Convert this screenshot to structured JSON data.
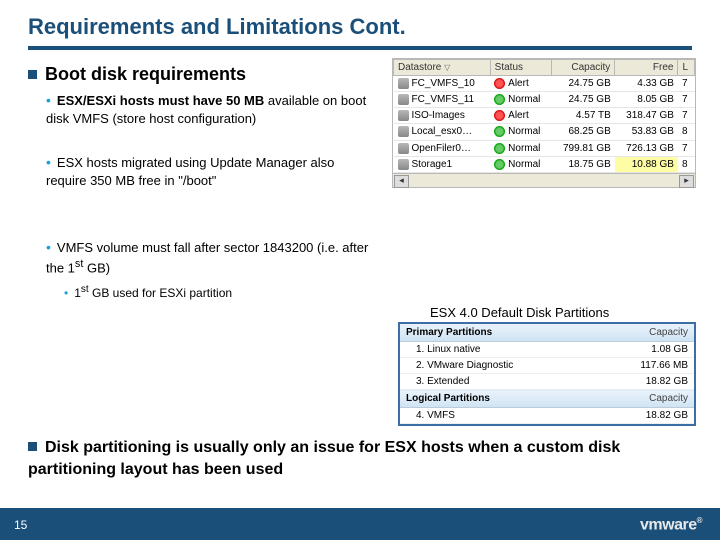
{
  "title": "Requirements and Limitations Cont.",
  "headings": {
    "h1": "Boot disk requirements",
    "b1": "ESX/ESXi hosts must have 50 MB",
    "b1_rest": " available on boot disk VMFS (store host configuration)",
    "b2": "ESX hosts migrated using Update Manager also require 350 MB free in \"/boot\"",
    "b3": "VMFS volume must fall after sector 1843200 (i.e. after the 1",
    "b3_sup": "st",
    "b3_rest": " GB)",
    "b3a": "1",
    "b3a_sup": "st",
    "b3a_rest": " GB used for ESXi partition"
  },
  "datastores": {
    "cols": {
      "c1": "Datastore",
      "c2": "Status",
      "c3": "Capacity",
      "c4": "Free",
      "c5": "L"
    },
    "rows": [
      {
        "name": "FC_VMFS_10",
        "status": "Alert",
        "s": "alert",
        "cap": "24.75 GB",
        "free": "4.33 GB",
        "l": "7"
      },
      {
        "name": "FC_VMFS_11",
        "status": "Normal",
        "s": "ok",
        "cap": "24.75 GB",
        "free": "8.05 GB",
        "l": "7"
      },
      {
        "name": "ISO-Images",
        "status": "Alert",
        "s": "alert",
        "cap": "4.57 TB",
        "free": "318.47 GB",
        "l": "7"
      },
      {
        "name": "Local_esx0…",
        "status": "Normal",
        "s": "ok",
        "cap": "68.25 GB",
        "free": "53.83 GB",
        "l": "8"
      },
      {
        "name": "OpenFiler0…",
        "status": "Normal",
        "s": "ok",
        "cap": "799.81 GB",
        "free": "726.13 GB",
        "l": "7"
      },
      {
        "name": "Storage1",
        "status": "Normal",
        "s": "ok",
        "cap": "18.75 GB",
        "free": "10.88 GB",
        "hl": true,
        "l": "8"
      }
    ]
  },
  "caption": "ESX 4.0 Default Disk Partitions",
  "partitions": {
    "h1": "Primary Partitions",
    "h1r": "Capacity",
    "r1": "1. Linux native",
    "r1v": "1.08 GB",
    "r2": "2. VMware Diagnostic",
    "r2v": "117.66 MB",
    "r3": "3. Extended",
    "r3v": "18.82 GB",
    "h2": "Logical Partitions",
    "h2r": "Capacity",
    "r4": "4. VMFS",
    "r4v": "18.82 GB"
  },
  "bottom": "Disk partitioning is usually only an issue for ESX hosts when a custom disk partitioning layout has been used",
  "page": "15",
  "logo": "vmware"
}
